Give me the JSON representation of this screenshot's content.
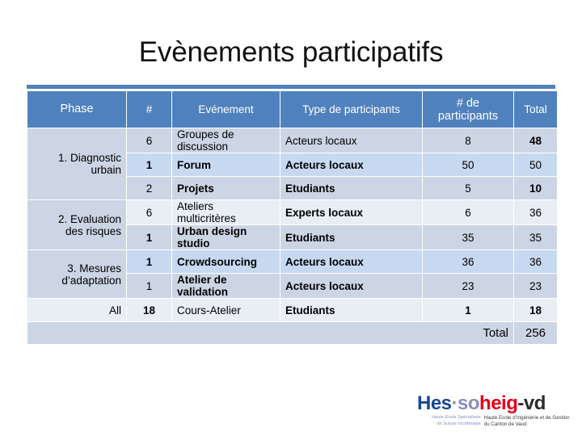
{
  "slide": {
    "title": "Evènements participatifs"
  },
  "table": {
    "headers": {
      "phase": "Phase",
      "count_events": "#",
      "event": "Evénement",
      "participant_type": "Type de participants",
      "participants_line1": "#  de",
      "participants_line2": "participants",
      "total": "Total"
    },
    "phases": {
      "p1_line1": "1. Diagnostic",
      "p1_line2": "urbain",
      "p2_line1": "2. Evaluation",
      "p2_line2": "des risques",
      "p3_line1": "3. Mesures",
      "p3_line2": "d’adaptation",
      "p4": "All"
    },
    "rows": [
      {
        "n": "6",
        "event_l1": "Groupes de",
        "event_l2": "discussion",
        "type": "Acteurs locaux",
        "participants": "8",
        "total": "48"
      },
      {
        "n": "1",
        "event_l1": "Forum",
        "event_l2": "",
        "type": "Acteurs locaux",
        "participants": "50",
        "total": "50"
      },
      {
        "n": "2",
        "event_l1": "Projets",
        "event_l2": "",
        "type": "Etudiants",
        "participants": "5",
        "total": "10"
      },
      {
        "n": "6",
        "event_l1": "Ateliers",
        "event_l2": "multicritères",
        "type": "Experts locaux",
        "participants": "6",
        "total": "36"
      },
      {
        "n": "1",
        "event_l1": "Urban design",
        "event_l2": "studio",
        "type": "Etudiants",
        "participants": "35",
        "total": "35"
      },
      {
        "n": "1",
        "event_l1": "Crowdsourcing",
        "event_l2": "",
        "type": "Acteurs locaux",
        "participants": "36",
        "total": "36"
      },
      {
        "n": "1",
        "event_l1": "Atelier de",
        "event_l2": "validation",
        "type": "Acteurs locaux",
        "participants": "23",
        "total": "23"
      },
      {
        "n": "18",
        "event_l1": "Cours-Atelier",
        "event_l2": "",
        "type": "Etudiants",
        "participants": "1",
        "total": "18"
      }
    ],
    "grand_total": {
      "label": "Total",
      "value": "256"
    }
  },
  "logo": {
    "hes": "Hes",
    "dot": "·",
    "so": "so",
    "heig": "heig",
    "vd": "-vd",
    "sub_left_l1": "Haute Ecole Spécialisée",
    "sub_left_l2": "de Suisse occidentale",
    "sub_right_l1": "Haute Ecole d’Ingénierie et de Gestion",
    "sub_right_l2": "du Canton de Vaud"
  },
  "colors": {
    "header_blue": "#4f81bd",
    "band_a": "#ccd5e4",
    "band_b": "#c6d9f0",
    "band_c": "#e9edf4",
    "logo_hes_blue": "#18488f",
    "logo_so_violet": "#8a8fc0",
    "logo_heig_red": "#e2001a"
  }
}
